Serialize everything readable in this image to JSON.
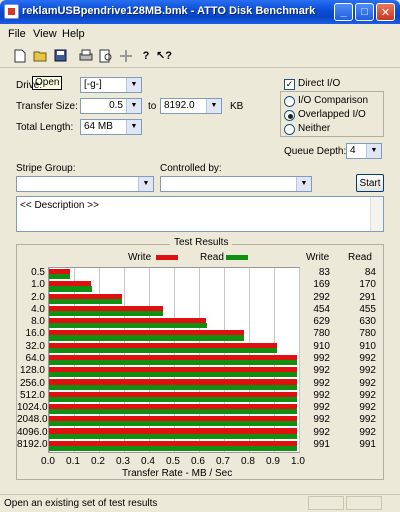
{
  "window": {
    "title": "reklamUSBpendrive128MB.bmk - ATTO Disk Benchmark"
  },
  "menu": [
    "File",
    "View",
    "Help"
  ],
  "tooltip": "Open",
  "form": {
    "drive_label": "Drive:",
    "drive_value": "[-g-]",
    "transfer_size_label": "Transfer Size:",
    "transfer_from": "0.5",
    "to_label": "to",
    "transfer_to": "8192.0",
    "kb_label": "KB",
    "total_length_label": "Total Length:",
    "total_length_value": "64 MB",
    "direct_io_label": "Direct I/O",
    "direct_io_checked": true,
    "io_comparison_label": "I/O Comparison",
    "overlapped_io_label": "Overlapped I/O",
    "neither_label": "Neither",
    "selected_io_mode": "Overlapped I/O",
    "queue_depth_label": "Queue Depth:",
    "queue_depth_value": "4",
    "stripe_group_label": "Stripe Group:",
    "stripe_group_value": "",
    "controlled_by_label": "Controlled by:",
    "controlled_by_value": "",
    "start_label": "Start",
    "description": "<< Description >>"
  },
  "results": {
    "title": "Test Results",
    "legend_write": "Write",
    "legend_read": "Read",
    "col_write": "Write",
    "col_read": "Read",
    "xlabel": "Transfer Rate - MB / Sec",
    "colors": {
      "write": "#e01010",
      "read": "#109010"
    }
  },
  "chart_data": {
    "type": "bar",
    "title": "Test Results",
    "xlabel": "Transfer Rate - MB / Sec",
    "xlim": [
      0,
      1.0
    ],
    "xticks": [
      "0.0",
      "0.1",
      "0.2",
      "0.3",
      "0.4",
      "0.5",
      "0.6",
      "0.7",
      "0.8",
      "0.9",
      "1.0"
    ],
    "categories": [
      "0.5",
      "1.0",
      "2.0",
      "4.0",
      "8.0",
      "16.0",
      "32.0",
      "64.0",
      "128.0",
      "256.0",
      "512.0",
      "1024.0",
      "2048.0",
      "4096.0",
      "8192.0"
    ],
    "series": [
      {
        "name": "Write",
        "values": [
          83,
          169,
          292,
          454,
          629,
          780,
          910,
          992,
          992,
          992,
          992,
          992,
          992,
          992,
          991
        ]
      },
      {
        "name": "Read",
        "values": [
          84,
          170,
          291,
          455,
          630,
          780,
          910,
          992,
          992,
          992,
          992,
          992,
          992,
          992,
          991
        ]
      }
    ]
  },
  "status": "Open an existing set of test results"
}
